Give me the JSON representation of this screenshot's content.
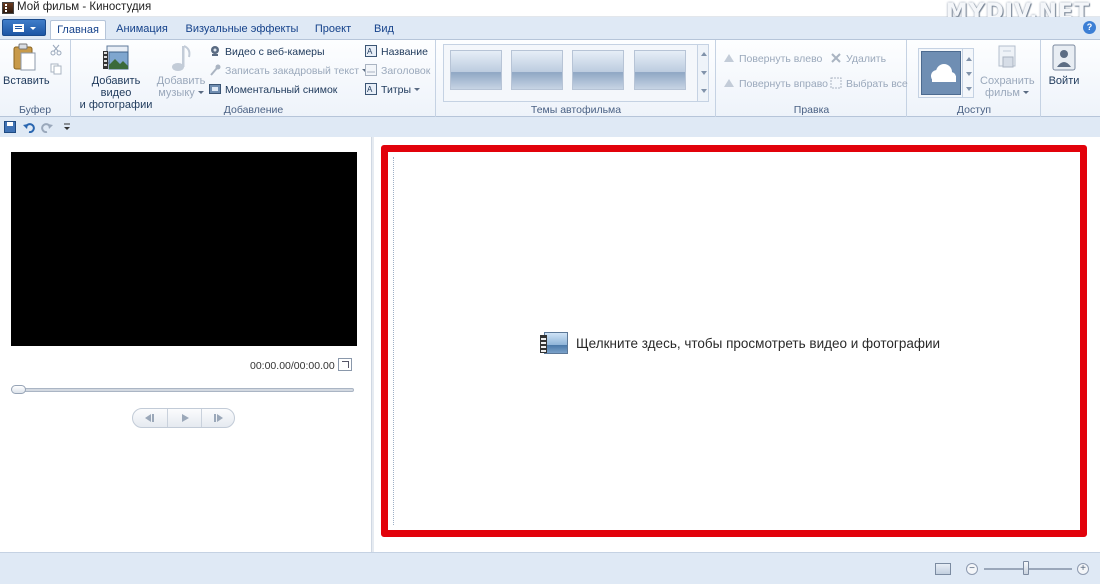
{
  "window": {
    "title": "Мой фильм - Киностудия",
    "watermark": "MYDIV.NET"
  },
  "tabs": [
    {
      "label": "Главная",
      "active": true
    },
    {
      "label": "Анимация"
    },
    {
      "label": "Визуальные эффекты"
    },
    {
      "label": "Проект"
    },
    {
      "label": "Вид"
    }
  ],
  "ribbon": {
    "clipboard": {
      "label": "Буфер",
      "paste": "Вставить"
    },
    "add": {
      "label": "Добавление",
      "add_media_line1": "Добавить видео",
      "add_media_line2": "и фотографии",
      "add_music_line1": "Добавить",
      "add_music_line2": "музыку",
      "webcam": "Видео с веб-камеры",
      "narration": "Записать закадровый текст",
      "snapshot": "Моментальный снимок",
      "title": "Название",
      "caption": "Заголовок",
      "credits": "Титры"
    },
    "themes": {
      "label": "Темы автофильма"
    },
    "edit": {
      "label": "Правка",
      "rotate_left": "Повернуть влево",
      "rotate_right": "Повернуть вправо",
      "remove": "Удалить",
      "select_all": "Выбрать все"
    },
    "share": {
      "label": "Доступ",
      "save_line1": "Сохранить",
      "save_line2": "фильм"
    },
    "signin": {
      "label": "Войти"
    }
  },
  "player": {
    "time": "00:00.00/00:00.00"
  },
  "storyboard": {
    "placeholder": "Щелкните здесь, чтобы просмотреть видео и фотографии"
  },
  "colors": {
    "highlight": "#e2020b",
    "ribbon_text": "#1e395b",
    "tab_text": "#15428b"
  }
}
